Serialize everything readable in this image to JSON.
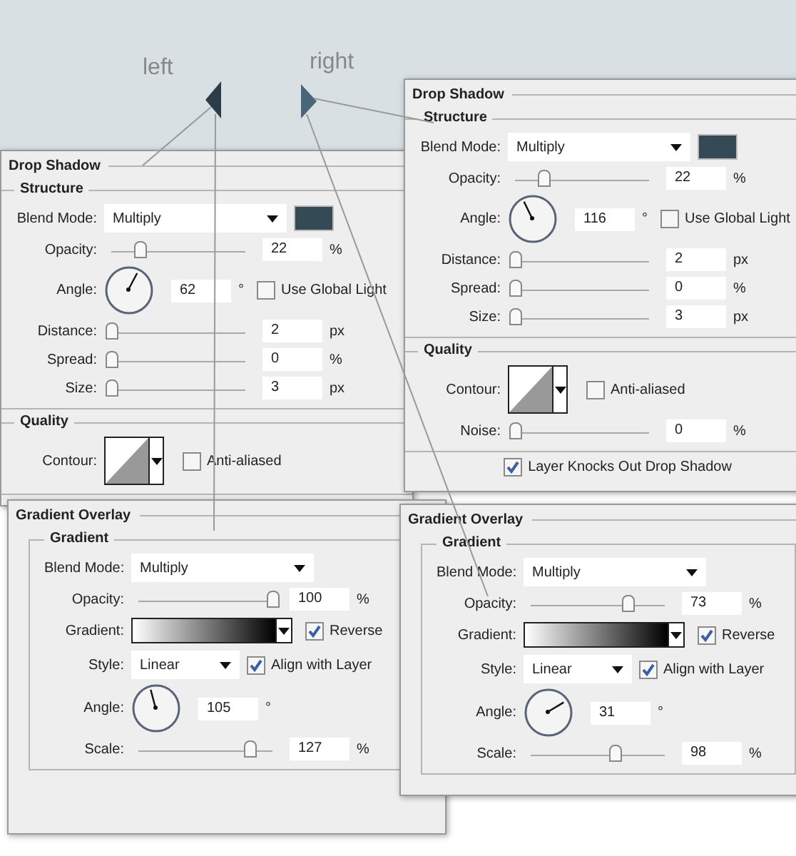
{
  "arrow_labels": [
    {
      "text": "left"
    },
    {
      "text": "right"
    }
  ],
  "panels": [
    {
      "kind": "drop_shadow",
      "title": "Drop Shadow",
      "sections": [
        {
          "title": "Structure",
          "rows": [
            {
              "kind": "select",
              "label": "Blend Mode:",
              "value": "Multiply",
              "color": "#344a55"
            },
            {
              "kind": "slider",
              "label": "Opacity:",
              "level": 0.22,
              "value": "22",
              "unit": "%"
            },
            {
              "kind": "angle",
              "label": "Angle:",
              "value": "62",
              "unit": "°",
              "checkbox": {
                "label": "Use Global Light",
                "checked": false
              }
            },
            {
              "kind": "slider",
              "label": "Distance:",
              "level": 0,
              "value": "2",
              "unit": "px"
            },
            {
              "kind": "slider",
              "label": "Spread:",
              "level": 0,
              "value": "0",
              "unit": "%"
            },
            {
              "kind": "slider",
              "label": "Size:",
              "level": 0,
              "value": "3",
              "unit": "px"
            }
          ]
        },
        {
          "title": "Quality",
          "rows": [
            {
              "kind": "contour",
              "label": "Contour:",
              "checkbox": {
                "label": "Anti-aliased",
                "checked": false
              }
            }
          ]
        }
      ]
    },
    {
      "kind": "gradient_overlay",
      "title": "Gradient Overlay",
      "sections": [
        {
          "title": "Gradient",
          "rows": [
            {
              "kind": "select",
              "label": "Blend Mode:",
              "value": "Multiply"
            },
            {
              "kind": "slider",
              "label": "Opacity:",
              "level": 1,
              "value": "100",
              "unit": "%"
            },
            {
              "kind": "gradient",
              "label": "Gradient:",
              "checkbox": {
                "label": "Reverse",
                "checked": true
              }
            },
            {
              "kind": "select",
              "label": "Style:",
              "value": "Linear",
              "checkbox": {
                "label": "Align with Layer",
                "checked": true
              }
            },
            {
              "kind": "angle",
              "label": "Angle:",
              "value": "105",
              "unit": "°"
            },
            {
              "kind": "slider",
              "label": "Scale:",
              "level": 0.84,
              "value": "127",
              "unit": "%"
            }
          ]
        }
      ]
    },
    {
      "kind": "drop_shadow",
      "title": "Drop Shadow",
      "sections": [
        {
          "title": "Structure",
          "rows": [
            {
              "kind": "select",
              "label": "Blend Mode:",
              "value": "Multiply",
              "color": "#344a55"
            },
            {
              "kind": "slider",
              "label": "Opacity:",
              "level": 0.22,
              "value": "22",
              "unit": "%"
            },
            {
              "kind": "angle",
              "label": "Angle:",
              "value": "116",
              "unit": "°",
              "checkbox": {
                "label": "Use Global Light",
                "checked": false
              }
            },
            {
              "kind": "slider",
              "label": "Distance:",
              "level": 0,
              "value": "2",
              "unit": "px"
            },
            {
              "kind": "slider",
              "label": "Spread:",
              "level": 0,
              "value": "0",
              "unit": "%"
            },
            {
              "kind": "slider",
              "label": "Size:",
              "level": 0,
              "value": "3",
              "unit": "px"
            }
          ]
        },
        {
          "title": "Quality",
          "rows": [
            {
              "kind": "contour",
              "label": "Contour:",
              "checkbox": {
                "label": "Anti-aliased",
                "checked": false
              }
            },
            {
              "kind": "slider",
              "label": "Noise:",
              "level": 0,
              "value": "0",
              "unit": "%"
            }
          ]
        }
      ],
      "footer": {
        "label": "Layer Knocks Out Drop Shadow",
        "checked": true
      }
    },
    {
      "kind": "gradient_overlay",
      "title": "Gradient Overlay",
      "sections": [
        {
          "title": "Gradient",
          "rows": [
            {
              "kind": "select",
              "label": "Blend Mode:",
              "value": "Multiply"
            },
            {
              "kind": "slider",
              "label": "Opacity:",
              "level": 0.73,
              "value": "73",
              "unit": "%"
            },
            {
              "kind": "gradient",
              "label": "Gradient:",
              "checkbox": {
                "label": "Reverse",
                "checked": true
              }
            },
            {
              "kind": "select",
              "label": "Style:",
              "value": "Linear",
              "checkbox": {
                "label": "Align with Layer",
                "checked": true
              }
            },
            {
              "kind": "angle",
              "label": "Angle:",
              "value": "31",
              "unit": "°"
            },
            {
              "kind": "slider",
              "label": "Scale:",
              "level": 0.63,
              "value": "98",
              "unit": "%"
            }
          ]
        }
      ]
    }
  ]
}
